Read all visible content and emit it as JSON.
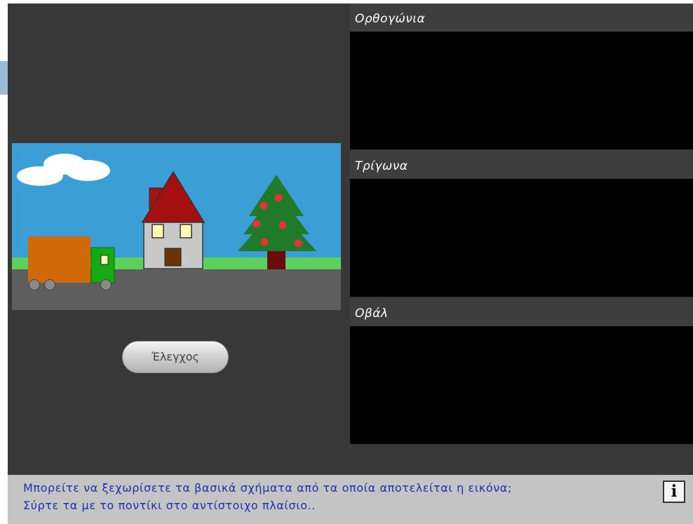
{
  "panels": [
    {
      "label": "Ορθογώνια"
    },
    {
      "label": "Τρίγωνα"
    },
    {
      "label": "Οβάλ"
    }
  ],
  "check_button": {
    "label": "Έλεγχος"
  },
  "instructions": {
    "line1": "Μπορείτε να ξεχωρίσετε τα βασικά σχήματα από τα οποία αποτελείται η εικόνα;",
    "line2": "Σύρτε τα με το ποντίκι στο αντίστοιχο πλαίσιο.."
  },
  "info_button": {
    "label": "i"
  },
  "colors": {
    "background": "#383838",
    "panel_drop": "#000000",
    "sky": "#3b9fd6",
    "road": "#5e5e5e",
    "grass": "#5ccf5c",
    "instruction_text": "#1f2fb3"
  },
  "icons": [
    "info-icon"
  ]
}
